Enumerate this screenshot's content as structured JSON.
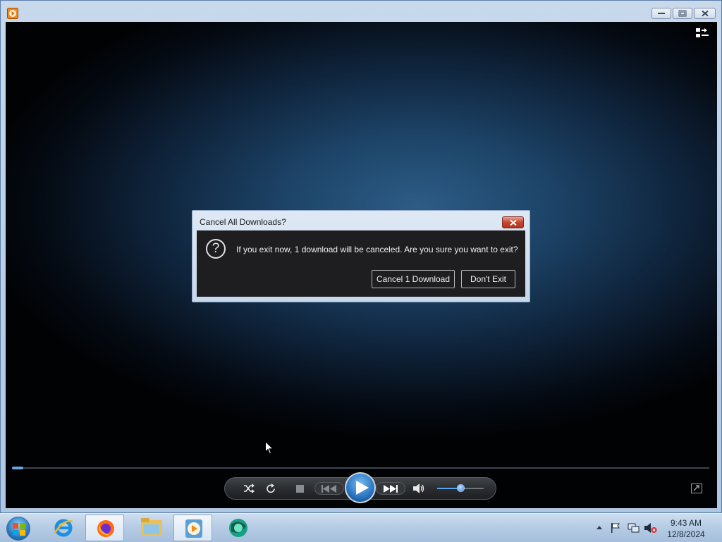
{
  "window": {
    "app_icon": "media-player-icon",
    "controls": [
      "minimize",
      "restore",
      "close"
    ]
  },
  "dialog": {
    "title": "Cancel All Downloads?",
    "message": "If you exit now, 1 download will be canceled. Are you sure you want to exit?",
    "icon": "question-icon",
    "cancel_button_label": "Cancel 1 Download",
    "dont_exit_button_label": "Don't Exit"
  },
  "player": {
    "seek_progress": 0.015,
    "volume_level": 0.5,
    "controls": [
      "shuffle",
      "repeat",
      "stop",
      "previous",
      "play",
      "next",
      "mute",
      "volume",
      "switch-to-library"
    ]
  },
  "taskbar": {
    "apps": [
      "internet-explorer",
      "firefox",
      "file-explorer",
      "windows-media-player",
      "app-green-circle"
    ],
    "tray_icons": [
      "show-hidden-icons",
      "action-center-flag",
      "network",
      "volume-muted"
    ],
    "clock_time": "9:43 AM",
    "clock_date": "12/8/2024"
  },
  "colors": {
    "accent": "#2874c2",
    "dialog_bg": "#1e1e21",
    "close_red": "#c8452f"
  }
}
